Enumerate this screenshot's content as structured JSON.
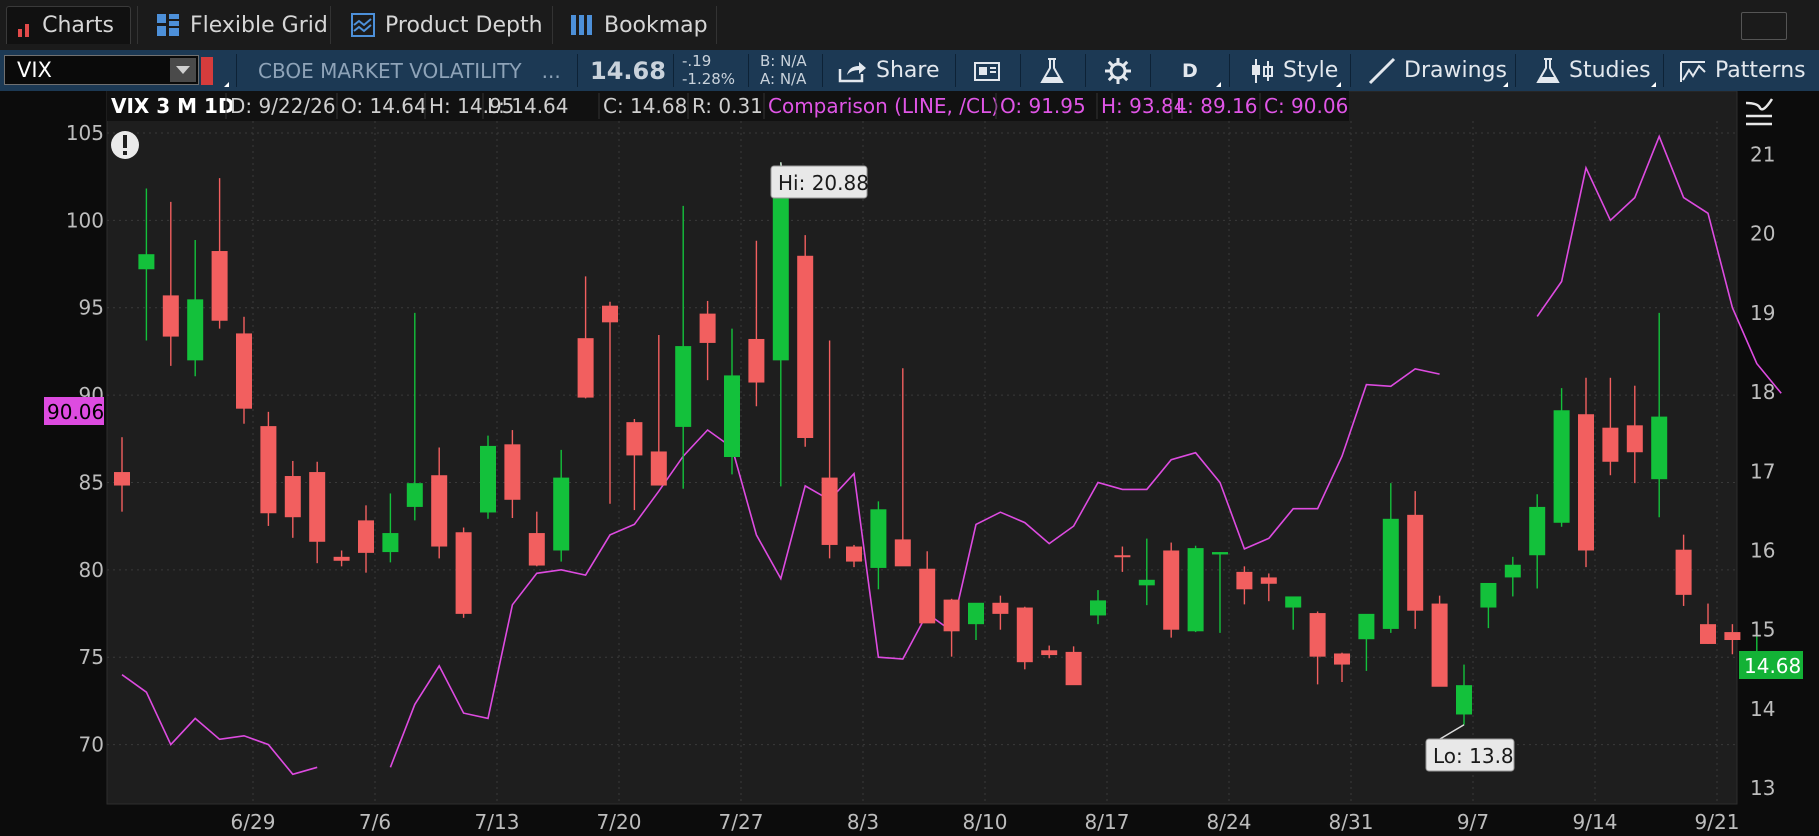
{
  "tabs": [
    {
      "label": "Charts",
      "icon": "bar-chart-icon"
    },
    {
      "label": "Flexible Grid",
      "icon": "grid-icon"
    },
    {
      "label": "Product Depth",
      "icon": "depth-icon"
    },
    {
      "label": "Bookmap",
      "icon": "bookmap-icon"
    }
  ],
  "toolbar": {
    "symbol": "VIX",
    "description": "CBOE MARKET VOLATILITY",
    "ellipsis": "...",
    "last": "14.68",
    "net_change": "-.19",
    "pct_change": "-1.28%",
    "bid": "B: N/A",
    "ask": "A: N/A",
    "share_label": "Share",
    "period": "D",
    "style_label": "Style",
    "drawings_label": "Drawings",
    "studies_label": "Studies",
    "patterns_label": "Patterns"
  },
  "header": {
    "title": "VIX 3 M 1D",
    "date": "D: 9/22/26",
    "open": "O: 14.64",
    "high": "H: 14.95",
    "low": "L: 14.64",
    "close": "C: 14.68",
    "range": "R: 0.31",
    "comparison": "Comparison (LINE, /CL)",
    "cmp_open": "O: 91.95",
    "cmp_high": "H: 93.84",
    "cmp_low": "L: 89.16",
    "cmp_close": "C: 90.06"
  },
  "labels": {
    "hi": "Hi: 20.88",
    "lo": "Lo: 13.8",
    "last_price": "14.68",
    "cmp_last": "90.06"
  },
  "colors": {
    "background": "#1e1e1e",
    "up": "#13c13b",
    "down": "#f25f5f",
    "comparison": "#dd4be0",
    "grid": "#3a3a3a"
  },
  "chart_data": {
    "type": "candlestick",
    "title": "VIX 3 M 1D",
    "x_tick_labels": [
      "6/29",
      "7/6",
      "7/13",
      "7/20",
      "7/27",
      "8/3",
      "8/10",
      "8/17",
      "8/24",
      "8/31",
      "9/7",
      "9/14",
      "9/21"
    ],
    "right_axis": {
      "ticks": [
        13,
        14,
        15,
        16,
        17,
        18,
        19,
        20,
        21
      ],
      "range": [
        12.8,
        21.8
      ]
    },
    "left_axis": {
      "ticks": [
        70,
        75,
        80,
        85,
        90,
        95,
        100,
        105
      ],
      "range": [
        66.6,
        107.4
      ]
    },
    "series": [
      {
        "name": "VIX",
        "candles": [
          {
            "o": 16.99,
            "h": 17.43,
            "l": 16.49,
            "c": 16.82
          },
          {
            "o": 19.55,
            "h": 20.57,
            "l": 18.65,
            "c": 19.74
          },
          {
            "o": 19.22,
            "h": 20.4,
            "l": 18.33,
            "c": 18.7
          },
          {
            "o": 18.4,
            "h": 19.92,
            "l": 18.2,
            "c": 19.17
          },
          {
            "o": 19.78,
            "h": 20.7,
            "l": 18.8,
            "c": 18.9
          },
          {
            "o": 18.74,
            "h": 18.95,
            "l": 17.6,
            "c": 17.79
          },
          {
            "o": 17.57,
            "h": 17.75,
            "l": 16.31,
            "c": 16.47
          },
          {
            "o": 16.94,
            "h": 17.13,
            "l": 16.16,
            "c": 16.42
          },
          {
            "o": 16.99,
            "h": 17.12,
            "l": 15.84,
            "c": 16.11
          },
          {
            "o": 15.92,
            "h": 16.0,
            "l": 15.8,
            "c": 15.87
          },
          {
            "o": 16.38,
            "h": 16.57,
            "l": 15.72,
            "c": 15.97
          },
          {
            "o": 15.98,
            "h": 16.72,
            "l": 15.85,
            "c": 16.22
          },
          {
            "o": 16.55,
            "h": 19.0,
            "l": 16.38,
            "c": 16.85
          },
          {
            "o": 16.95,
            "h": 17.3,
            "l": 15.9,
            "c": 16.05
          },
          {
            "o": 16.23,
            "h": 16.29,
            "l": 15.15,
            "c": 15.2
          },
          {
            "o": 16.48,
            "h": 17.45,
            "l": 16.4,
            "c": 17.32
          },
          {
            "o": 17.34,
            "h": 17.52,
            "l": 16.41,
            "c": 16.64
          },
          {
            "o": 16.22,
            "h": 16.49,
            "l": 15.8,
            "c": 15.81
          },
          {
            "o": 16.0,
            "h": 17.27,
            "l": 15.86,
            "c": 16.92
          },
          {
            "o": 18.68,
            "h": 19.46,
            "l": 17.92,
            "c": 17.93
          },
          {
            "o": 19.09,
            "h": 19.14,
            "l": 16.59,
            "c": 18.88
          },
          {
            "o": 17.62,
            "h": 17.66,
            "l": 16.51,
            "c": 17.2
          },
          {
            "o": 17.25,
            "h": 18.72,
            "l": 16.84,
            "c": 16.82
          },
          {
            "o": 17.56,
            "h": 20.35,
            "l": 16.78,
            "c": 18.58
          },
          {
            "o": 18.99,
            "h": 19.15,
            "l": 18.15,
            "c": 18.62
          },
          {
            "o": 17.18,
            "h": 18.8,
            "l": 16.96,
            "c": 18.21
          },
          {
            "o": 18.67,
            "h": 19.91,
            "l": 17.82,
            "c": 18.12
          },
          {
            "o": 18.4,
            "h": 20.9,
            "l": 16.81,
            "c": 20.83
          },
          {
            "o": 19.72,
            "h": 19.98,
            "l": 17.31,
            "c": 17.42
          },
          {
            "o": 16.92,
            "h": 18.65,
            "l": 15.9,
            "c": 16.07
          },
          {
            "o": 16.05,
            "h": 16.07,
            "l": 15.79,
            "c": 15.86
          },
          {
            "o": 15.78,
            "h": 16.62,
            "l": 15.51,
            "c": 16.52
          },
          {
            "o": 16.14,
            "h": 18.3,
            "l": 15.85,
            "c": 15.8
          },
          {
            "o": 15.77,
            "h": 15.99,
            "l": 15.15,
            "c": 15.08
          },
          {
            "o": 15.38,
            "h": 15.39,
            "l": 14.66,
            "c": 14.98
          },
          {
            "o": 15.07,
            "h": 15.24,
            "l": 14.87,
            "c": 15.34
          },
          {
            "o": 15.34,
            "h": 15.43,
            "l": 15.0,
            "c": 15.2
          },
          {
            "o": 15.28,
            "h": 15.29,
            "l": 14.5,
            "c": 14.59
          },
          {
            "o": 14.74,
            "h": 14.8,
            "l": 14.64,
            "c": 14.68
          },
          {
            "o": 14.72,
            "h": 14.79,
            "l": 14.31,
            "c": 14.3
          },
          {
            "o": 15.18,
            "h": 15.5,
            "l": 15.07,
            "c": 15.37
          },
          {
            "o": 15.94,
            "h": 16.05,
            "l": 15.73,
            "c": 15.93
          },
          {
            "o": 15.56,
            "h": 16.15,
            "l": 15.31,
            "c": 15.63
          },
          {
            "o": 16.0,
            "h": 16.1,
            "l": 14.9,
            "c": 15.0
          },
          {
            "o": 14.98,
            "h": 16.06,
            "l": 14.97,
            "c": 16.03
          },
          {
            "o": 15.95,
            "h": 15.98,
            "l": 14.96,
            "c": 15.98
          },
          {
            "o": 15.73,
            "h": 15.8,
            "l": 15.32,
            "c": 15.51
          },
          {
            "o": 15.66,
            "h": 15.71,
            "l": 15.36,
            "c": 15.58
          },
          {
            "o": 15.28,
            "h": 15.32,
            "l": 15.0,
            "c": 15.42
          },
          {
            "o": 15.21,
            "h": 15.23,
            "l": 14.31,
            "c": 14.66
          },
          {
            "o": 14.7,
            "h": 14.71,
            "l": 14.34,
            "c": 14.56
          },
          {
            "o": 14.88,
            "h": 15.09,
            "l": 14.48,
            "c": 15.2
          },
          {
            "o": 15.01,
            "h": 16.85,
            "l": 14.96,
            "c": 16.4
          },
          {
            "o": 16.45,
            "h": 16.75,
            "l": 15.01,
            "c": 15.24
          },
          {
            "o": 15.33,
            "h": 15.43,
            "l": 14.46,
            "c": 14.28
          },
          {
            "o": 13.93,
            "h": 14.56,
            "l": 13.8,
            "c": 14.3
          },
          {
            "o": 15.28,
            "h": 15.45,
            "l": 15.02,
            "c": 15.59
          },
          {
            "o": 15.66,
            "h": 15.92,
            "l": 15.42,
            "c": 15.82
          },
          {
            "o": 15.94,
            "h": 16.71,
            "l": 15.52,
            "c": 16.55
          },
          {
            "o": 16.35,
            "h": 18.05,
            "l": 16.3,
            "c": 17.77
          },
          {
            "o": 17.72,
            "h": 18.18,
            "l": 15.79,
            "c": 16.0
          },
          {
            "o": 17.55,
            "h": 18.18,
            "l": 16.95,
            "c": 17.12
          },
          {
            "o": 17.58,
            "h": 18.08,
            "l": 16.85,
            "c": 17.24
          },
          {
            "o": 16.9,
            "h": 19.0,
            "l": 16.42,
            "c": 17.69
          },
          {
            "o": 16.01,
            "h": 16.2,
            "l": 15.3,
            "c": 15.44
          },
          {
            "o": 15.07,
            "h": 15.33,
            "l": 14.82,
            "c": 14.82
          },
          {
            "o": 14.97,
            "h": 15.07,
            "l": 14.69,
            "c": 14.87
          },
          {
            "o": 14.64,
            "h": 14.95,
            "l": 14.64,
            "c": 14.68
          }
        ]
      },
      {
        "name": "Comparison (LINE, /CL)",
        "type": "line",
        "axis": "left",
        "values": [
          74.0,
          73.0,
          70.0,
          71.5,
          70.3,
          70.5,
          70.0,
          68.3,
          68.7,
          null,
          null,
          68.7,
          72.3,
          74.5,
          71.8,
          71.5,
          78.0,
          79.8,
          80.0,
          79.7,
          82.0,
          82.6,
          84.5,
          86.5,
          88.0,
          87.0,
          82.0,
          79.5,
          84.8,
          84.0,
          85.5,
          75.0,
          74.9,
          77.5,
          76.5,
          82.6,
          83.3,
          82.7,
          81.5,
          82.5,
          85.0,
          84.6,
          84.6,
          86.3,
          86.7,
          85.0,
          81.2,
          81.8,
          83.5,
          83.5,
          86.5,
          90.6,
          90.5,
          91.5,
          91.2,
          null,
          null,
          null,
          94.5,
          96.5,
          103.0,
          100.0,
          101.3,
          104.8,
          101.3,
          100.4,
          95.0,
          91.8,
          90.1
        ]
      }
    ],
    "annotations": [
      "Hi: 20.88",
      "Lo: 13.8"
    ]
  }
}
